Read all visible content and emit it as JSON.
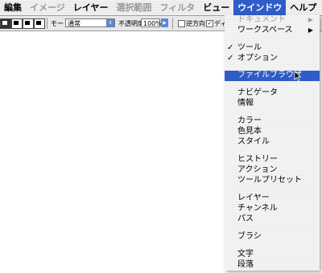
{
  "menubar": {
    "items": [
      "編集",
      "イメージ",
      "レイヤー",
      "選択範囲",
      "フィルタ",
      "ビュー",
      "ウインドウ",
      "ヘルプ"
    ],
    "disabled": [
      false,
      true,
      false,
      true,
      true,
      false,
      false,
      false
    ],
    "active_index": 6,
    "flag_icon": "us-flag-icon"
  },
  "options": {
    "mode_label": "モード：",
    "mode_value": "通常",
    "opacity_label": "不透明度",
    "opacity_value": "100%",
    "reverse_label": "逆方向",
    "dither_label": "ディザ",
    "dither_checked": true,
    "reverse_checked": false
  },
  "window_menu": {
    "highlight_color": "#2f5cc7",
    "items": [
      {
        "label": "ドキュメント",
        "disabled": true,
        "submenu": true
      },
      {
        "label": "ワークスペース",
        "submenu": true
      },
      {
        "label": "ツール",
        "checked": true
      },
      {
        "label": "オプション",
        "checked": true
      },
      {
        "label": "ファイルブラウザ",
        "highlighted": true
      },
      {
        "label": "ナビゲータ"
      },
      {
        "label": "情報"
      },
      {
        "label": "カラー"
      },
      {
        "label": "色見本"
      },
      {
        "label": "スタイル"
      },
      {
        "label": "ヒストリー"
      },
      {
        "label": "アクション"
      },
      {
        "label": "ツールプリセット"
      },
      {
        "label": "レイヤー"
      },
      {
        "label": "チャンネル"
      },
      {
        "label": "パス"
      },
      {
        "label": "ブラシ"
      },
      {
        "label": "文字"
      },
      {
        "label": "段落"
      }
    ]
  }
}
